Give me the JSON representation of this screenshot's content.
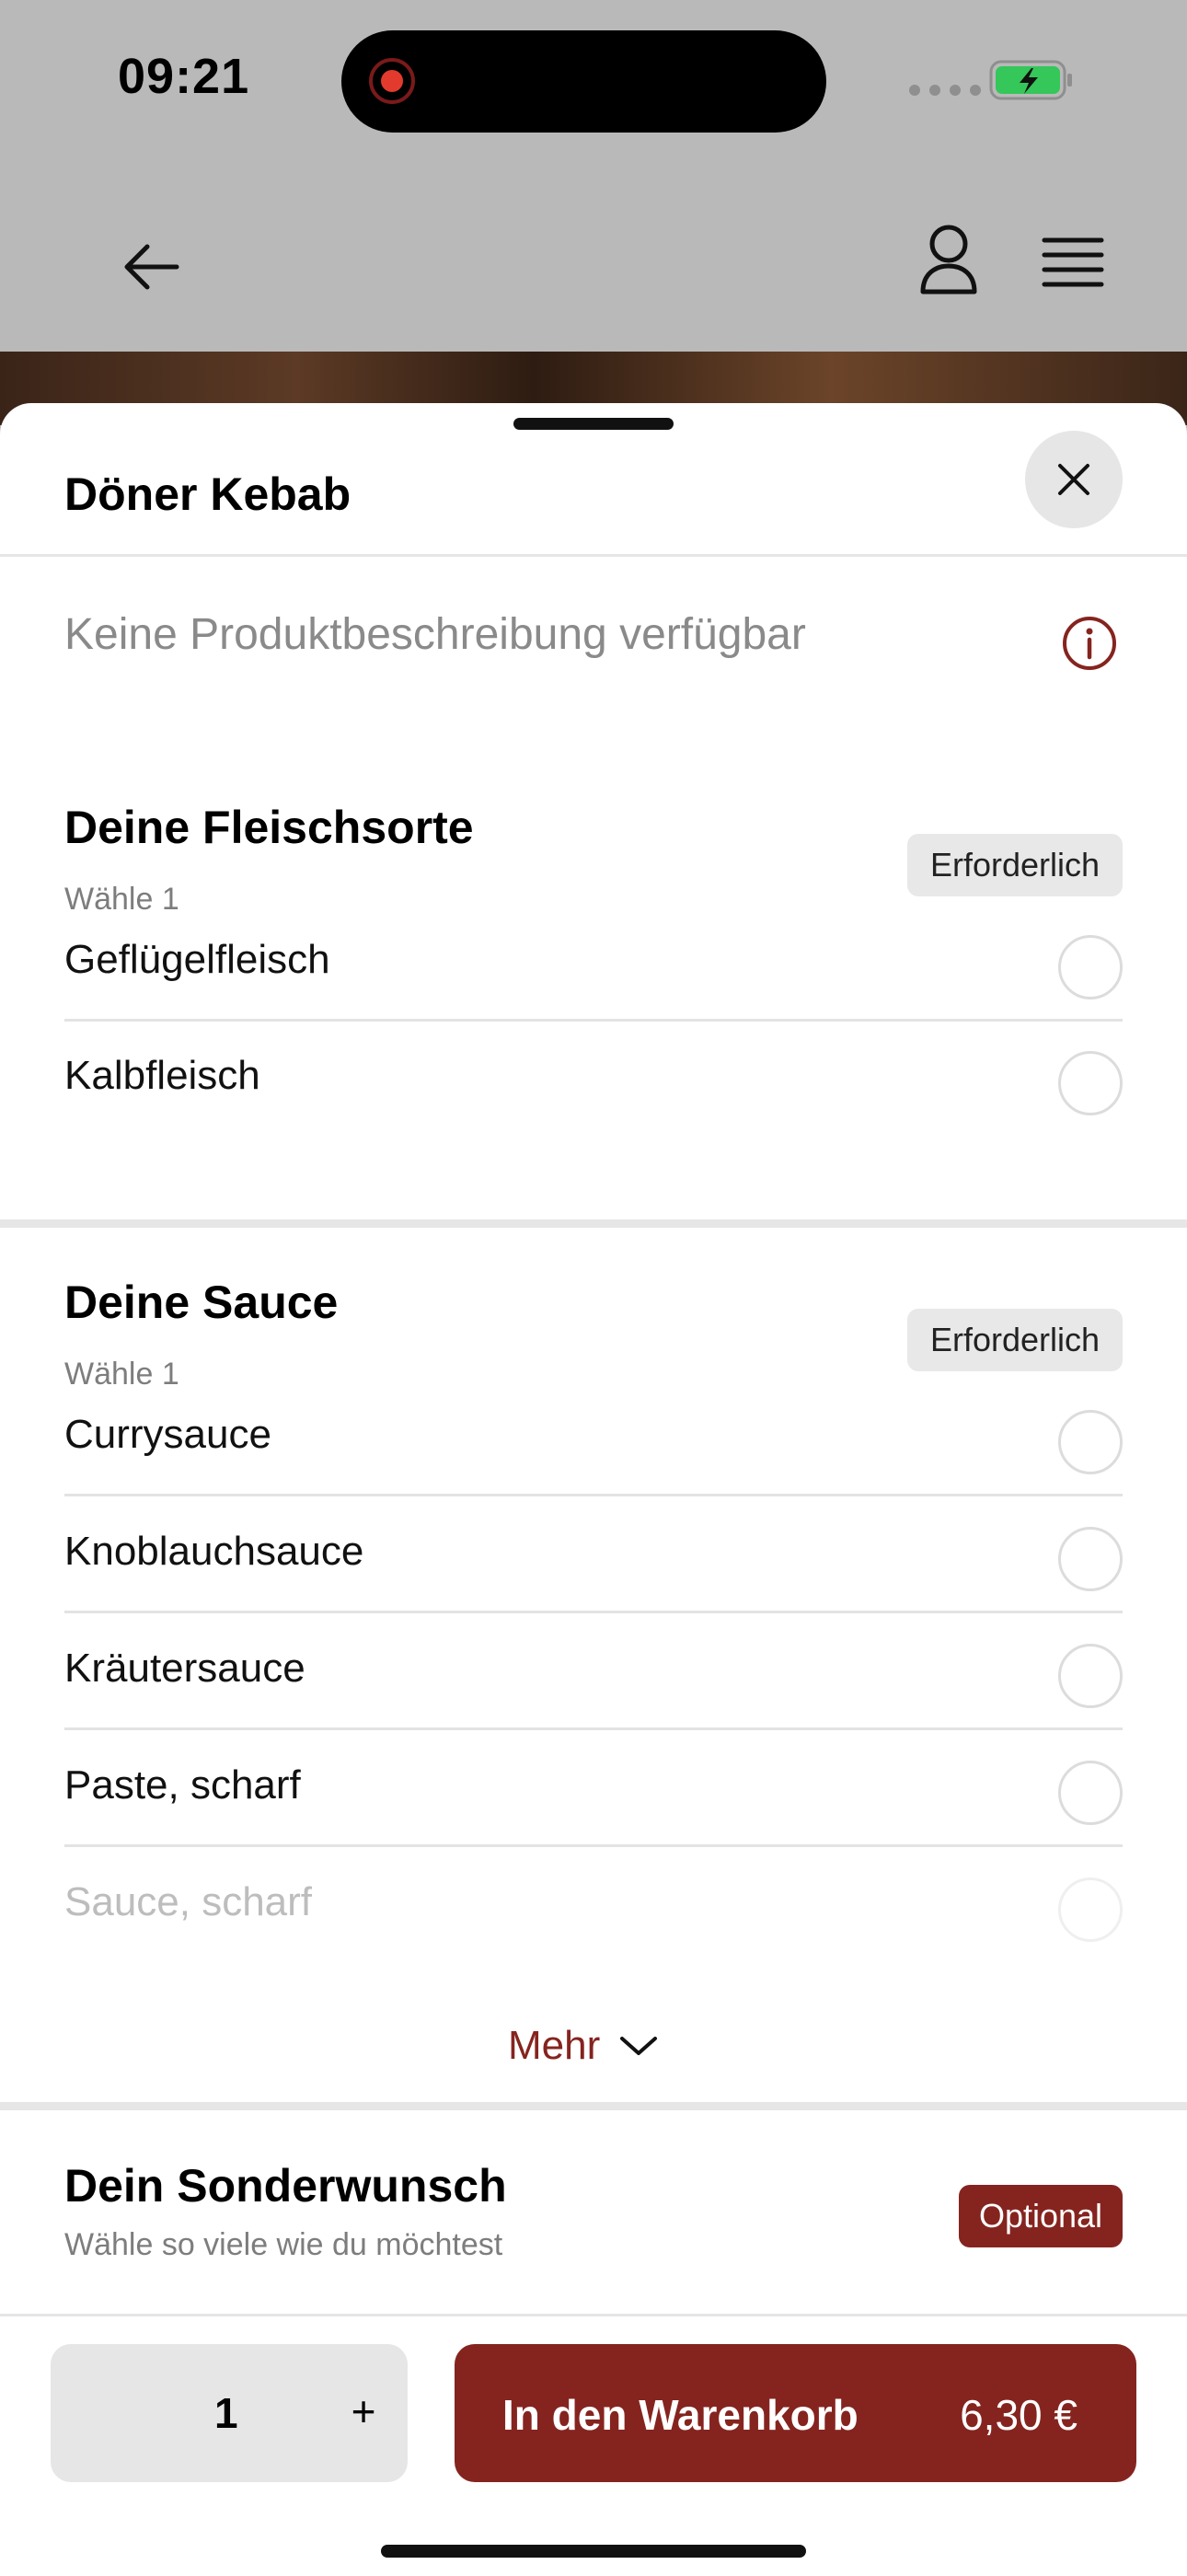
{
  "status_bar": {
    "time": "09:21"
  },
  "sheet": {
    "title": "Döner Kebab",
    "description": "Keine Produktbeschreibung verfügbar"
  },
  "sections": {
    "meat": {
      "title": "Deine Fleischsorte",
      "subtitle": "Wähle 1",
      "badge": "Erforderlich",
      "options": [
        "Geflügelfleisch",
        "Kalbfleisch"
      ]
    },
    "sauce": {
      "title": "Deine Sauce",
      "subtitle": "Wähle 1",
      "badge": "Erforderlich",
      "options": [
        "Currysauce",
        "Knoblauchsauce",
        "Kräutersauce",
        "Paste, scharf",
        "Sauce, scharf"
      ],
      "more_label": "Mehr"
    },
    "extras": {
      "title": "Dein Sonderwunsch",
      "subtitle": "Wähle so viele wie du möchtest",
      "badge": "Optional"
    }
  },
  "bottom_bar": {
    "quantity": "1",
    "plus_label": "+",
    "cart_label": "In den Warenkorb",
    "price": "6,30 €"
  },
  "colors": {
    "accent": "#85241f",
    "overlay": "#b9b9b9"
  }
}
